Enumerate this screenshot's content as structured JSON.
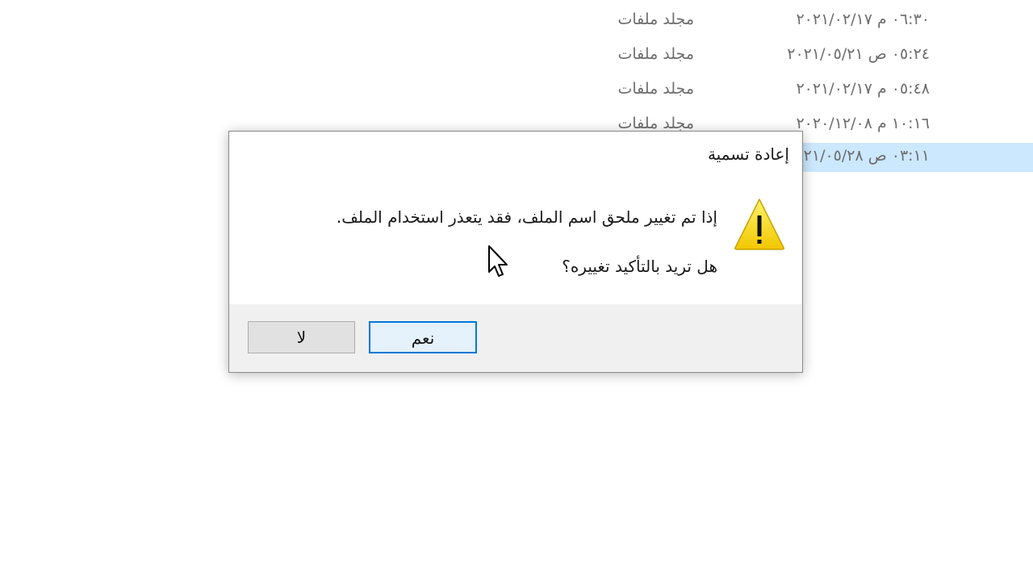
{
  "explorer": {
    "rows": [
      {
        "date": "٠٦:٣٠ م ٢٠٢١/٠٢/١٧",
        "type": "مجلد ملفات"
      },
      {
        "date": "٠٥:٢٤ ص ٢٠٢١/٠٥/٢١",
        "type": "مجلد ملفات"
      },
      {
        "date": "٠٥:٤٨ م ٢٠٢١/٠٢/١٧",
        "type": "مجلد ملفات"
      },
      {
        "date": "١٠:١٦ م ٢٠٢٠/١٢/٠٨",
        "type": "مجلد ملفات"
      },
      {
        "date": "٠٣:١١ ص ٢٠٢١/٠٥/٢٨",
        "type": ""
      }
    ],
    "selected_row_color": "#cce8ff"
  },
  "dialog": {
    "title": "إعادة تسمية",
    "message": "إذا تم تغيير ملحق اسم الملف، فقد يتعذر استخدام الملف.",
    "question": "هل تريد بالتأكيد تغييره؟",
    "icon": "warning-icon",
    "yes_label": "نعم",
    "no_label": "لا",
    "accent_color": "#0078d7"
  }
}
